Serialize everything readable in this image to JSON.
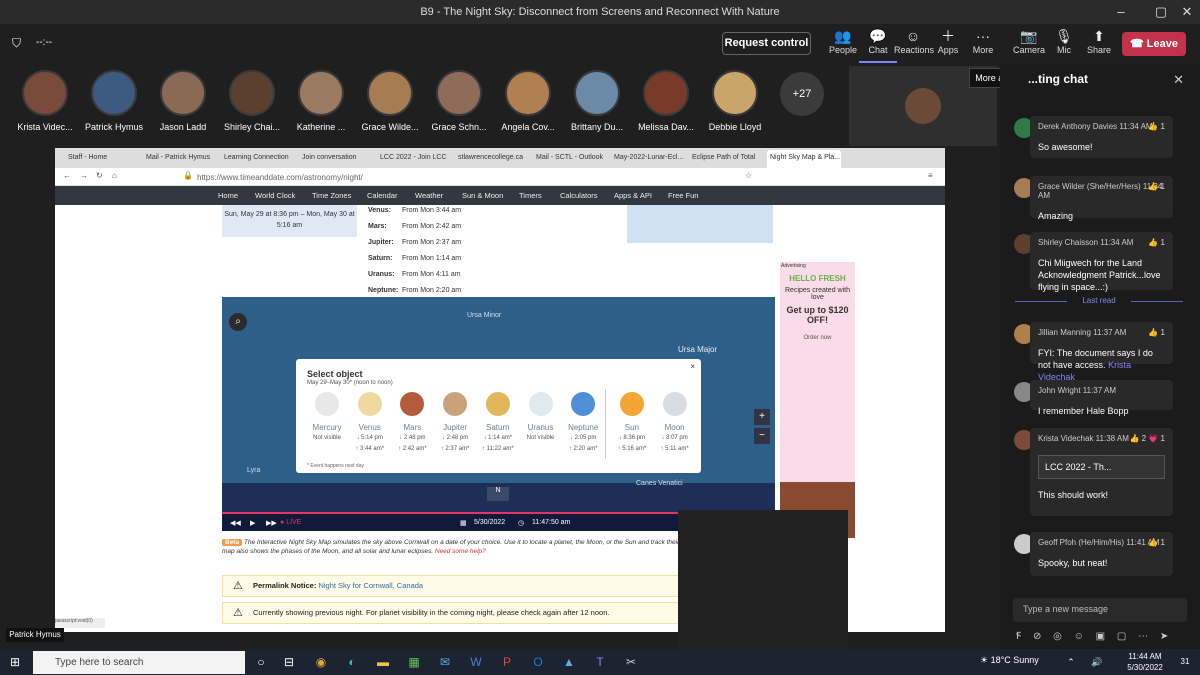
{
  "window": {
    "title": "B9 - The Night Sky: Disconnect from Screens and Reconnect With Nature",
    "timer": "--:--"
  },
  "meeting_bar": {
    "request_control": "Request control",
    "people": "People",
    "chat": "Chat",
    "reactions": "Reactions",
    "apps": "Apps",
    "more": "More",
    "camera": "Camera",
    "mic": "Mic",
    "share": "Share",
    "leave": "Leave",
    "tooltip": "More actions"
  },
  "participants": [
    {
      "name": "Krista Videc...",
      "color": "#7a4a3a"
    },
    {
      "name": "Patrick Hymus",
      "color": "#3d5a80"
    },
    {
      "name": "Jason Ladd",
      "color": "#8a6a55"
    },
    {
      "name": "Shirley Chai...",
      "color": "#5b4030"
    },
    {
      "name": "Katherine ...",
      "color": "#9a7a60"
    },
    {
      "name": "Grace Wilde...",
      "color": "#a67c52"
    },
    {
      "name": "Grace Schn...",
      "color": "#8e6b5a"
    },
    {
      "name": "Angela Cov...",
      "color": "#b08050"
    },
    {
      "name": "Brittany Du...",
      "color": "#6b8aa8"
    },
    {
      "name": "Melissa Dav...",
      "color": "#7a3a2a"
    },
    {
      "name": "Debbie Lloyd",
      "color": "#c9a56a"
    }
  ],
  "overflow_count": "+27",
  "chat": {
    "header": "...ting chat",
    "messages": [
      {
        "author": "Derek Anthony Davies",
        "time": "11:34 AM",
        "text": "So awesome!",
        "reaction": "👍 1",
        "color": "#2f7a4a"
      },
      {
        "author": "Grace Wilder (She/Her/Hers)",
        "time": "11:34 AM",
        "text": "Amazing",
        "reaction": "👍 1",
        "color": "#a67c52"
      },
      {
        "author": "Shirley Chaisson",
        "time": "11:34 AM",
        "text": "Chi Miigwech for the Land Acknowledgment Patrick...love flying in space...:)",
        "reaction": "👍 1",
        "color": "#5b4030"
      },
      {
        "author": "Jillian Manning",
        "time": "11:37 AM",
        "text": "FYI: The document says I do not have access.",
        "mention": "Krista Videchak",
        "reaction": "👍 1",
        "color": "#b0804a"
      },
      {
        "author": "John Wright",
        "time": "11:37 AM",
        "text": "I remember Hale Bopp",
        "reaction": "",
        "color": "#888"
      },
      {
        "author": "Krista Videchak",
        "time": "11:38 AM",
        "text": "This should work!",
        "reaction": "👍 2 💗 1",
        "file": "LCC 2022 - Th...",
        "color": "#7a4a3a"
      },
      {
        "author": "Geoff Pfoh (He/Him/His)",
        "time": "11:41 AM",
        "text": "Spooky, but neat!",
        "reaction": "👍 1",
        "color": "#ccc"
      }
    ],
    "last_read": "Last read",
    "new_message_placeholder": "Type a new message"
  },
  "browser": {
    "tabs": [
      "Staff - Home",
      "Mail - Patrick Hymus",
      "Learning Connection",
      "Join conversation",
      "LCC 2022 - Join LCC",
      "stlawrencecollege.ca",
      "Mail - SCTL - Outlook",
      "May-2022-Lunar-Ecl...",
      "Eclipse Path of Total",
      "Night Sky Map & Pla..."
    ],
    "url": "https://www.timeanddate.com/astronomy/night/",
    "nav": [
      "Home",
      "World Clock",
      "Time Zones",
      "Calendar",
      "Weather",
      "Sun & Moon",
      "Timers",
      "Calculators",
      "Apps & API",
      "Free Fun"
    ],
    "date_range": "Sun, May 29 at 8:36 pm – Mon, May 30 at 5:16 am",
    "planets": [
      {
        "name": "Venus:",
        "value": "From Mon 3:44 am"
      },
      {
        "name": "Mars:",
        "value": "From Mon 2:42 am"
      },
      {
        "name": "Jupiter:",
        "value": "From Mon 2:37 am"
      },
      {
        "name": "Saturn:",
        "value": "From Mon 1:14 am"
      },
      {
        "name": "Uranus:",
        "value": "From Mon 4:11 am"
      },
      {
        "name": "Neptune:",
        "value": "From Mon 2:20 am"
      }
    ],
    "ad": {
      "label": "Advertising",
      "brand": "HELLO FRESH",
      "line1": "Recipes created with love",
      "line2": "Get up to $120 OFF!",
      "cta": "Order now"
    },
    "sky": {
      "ursa_minor": "Ursa Minor",
      "ursa_major": "Ursa Major",
      "canes": "Canes Venatici",
      "lyra": "Lyra",
      "compass": "N",
      "live": "LIVE",
      "date": "5/30/2022",
      "time": "11:47:50 am"
    },
    "select": {
      "title": "Select object",
      "subtitle": "May 29–May 30* (noon to noon)",
      "close": "×",
      "footnote": "* Event happens next day",
      "objects": [
        {
          "name": "Mercury",
          "l1": "Not visible",
          "l2": "",
          "color": "#e8e8e8"
        },
        {
          "name": "Venus",
          "l1": "↓ 5:14 pm",
          "l2": "↑ 3:44 am*",
          "color": "#f0d9a0"
        },
        {
          "name": "Mars",
          "l1": "↓ 2:48 pm",
          "l2": "↑ 2:42 am*",
          "color": "#b55a3a"
        },
        {
          "name": "Jupiter",
          "l1": "↓ 2:48 pm",
          "l2": "↑ 2:37 am*",
          "color": "#c9a27a"
        },
        {
          "name": "Saturn",
          "l1": "↓ 1:14 am*",
          "l2": "↑ 11:22 am*",
          "color": "#e0b75a"
        },
        {
          "name": "Uranus",
          "l1": "Not visible",
          "l2": "",
          "color": "#dfe9ee"
        },
        {
          "name": "Neptune",
          "l1": "↓ 2:05 pm",
          "l2": "↑ 2:20 am*",
          "color": "#4f8fd8"
        },
        {
          "name": "Sun",
          "l1": "↓ 8:36 pm",
          "l2": "↑ 5:16 am*",
          "color": "#f2a531"
        },
        {
          "name": "Moon",
          "l1": "↓ 8:07 pm",
          "l2": "↑ 5:11 am*",
          "color": "#d8dde4"
        }
      ]
    },
    "beta_label": "Beta",
    "beta_text": "The Interactive Night Sky Map simulates the sky above Cornwall on a date of your choice. Use it to locate a planet, the Moon, or the Sun and track their movements across the sky. The map also shows the phases of the Moon, and all solar and lunar eclipses.",
    "need_help": "Need some help?",
    "permalink_label": "Permalink Notice:",
    "permalink_link": "Night Sky for Cornwall, Canada",
    "previous_night": "Currently showing previous night. For planet visibility in the coming night, please check again after 12 noon.",
    "status": "javascript:void(0)"
  },
  "speaker_label": "Patrick Hymus",
  "taskbar": {
    "search_placeholder": "Type here to search",
    "weather": "18°C  Sunny",
    "time": "11:44 AM",
    "date": "5/30/2022",
    "notifications": "31"
  }
}
